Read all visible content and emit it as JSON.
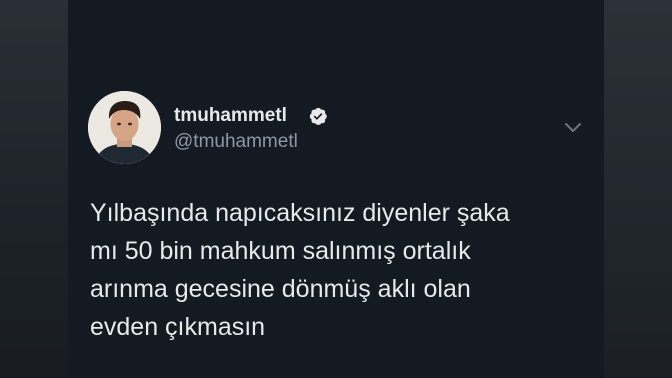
{
  "tweet": {
    "display_name": "tmuhammetl",
    "handle": "@tmuhammetl",
    "verified": true,
    "text": "Yılbaşında napıcaksınız diyenler şaka\nmı 50 bin mahkum salınmış ortalık\narınma gecesine dönmüş aklı olan\nevden çıkmasın"
  },
  "icons": {
    "verified": "verified-badge-icon",
    "more": "chevron-down-icon",
    "avatar": "profile-photo"
  },
  "colors": {
    "background": "#141a22",
    "text_primary": "#e7e9ea",
    "text_secondary": "#8b98a5",
    "accent": "#1d9bf0"
  }
}
